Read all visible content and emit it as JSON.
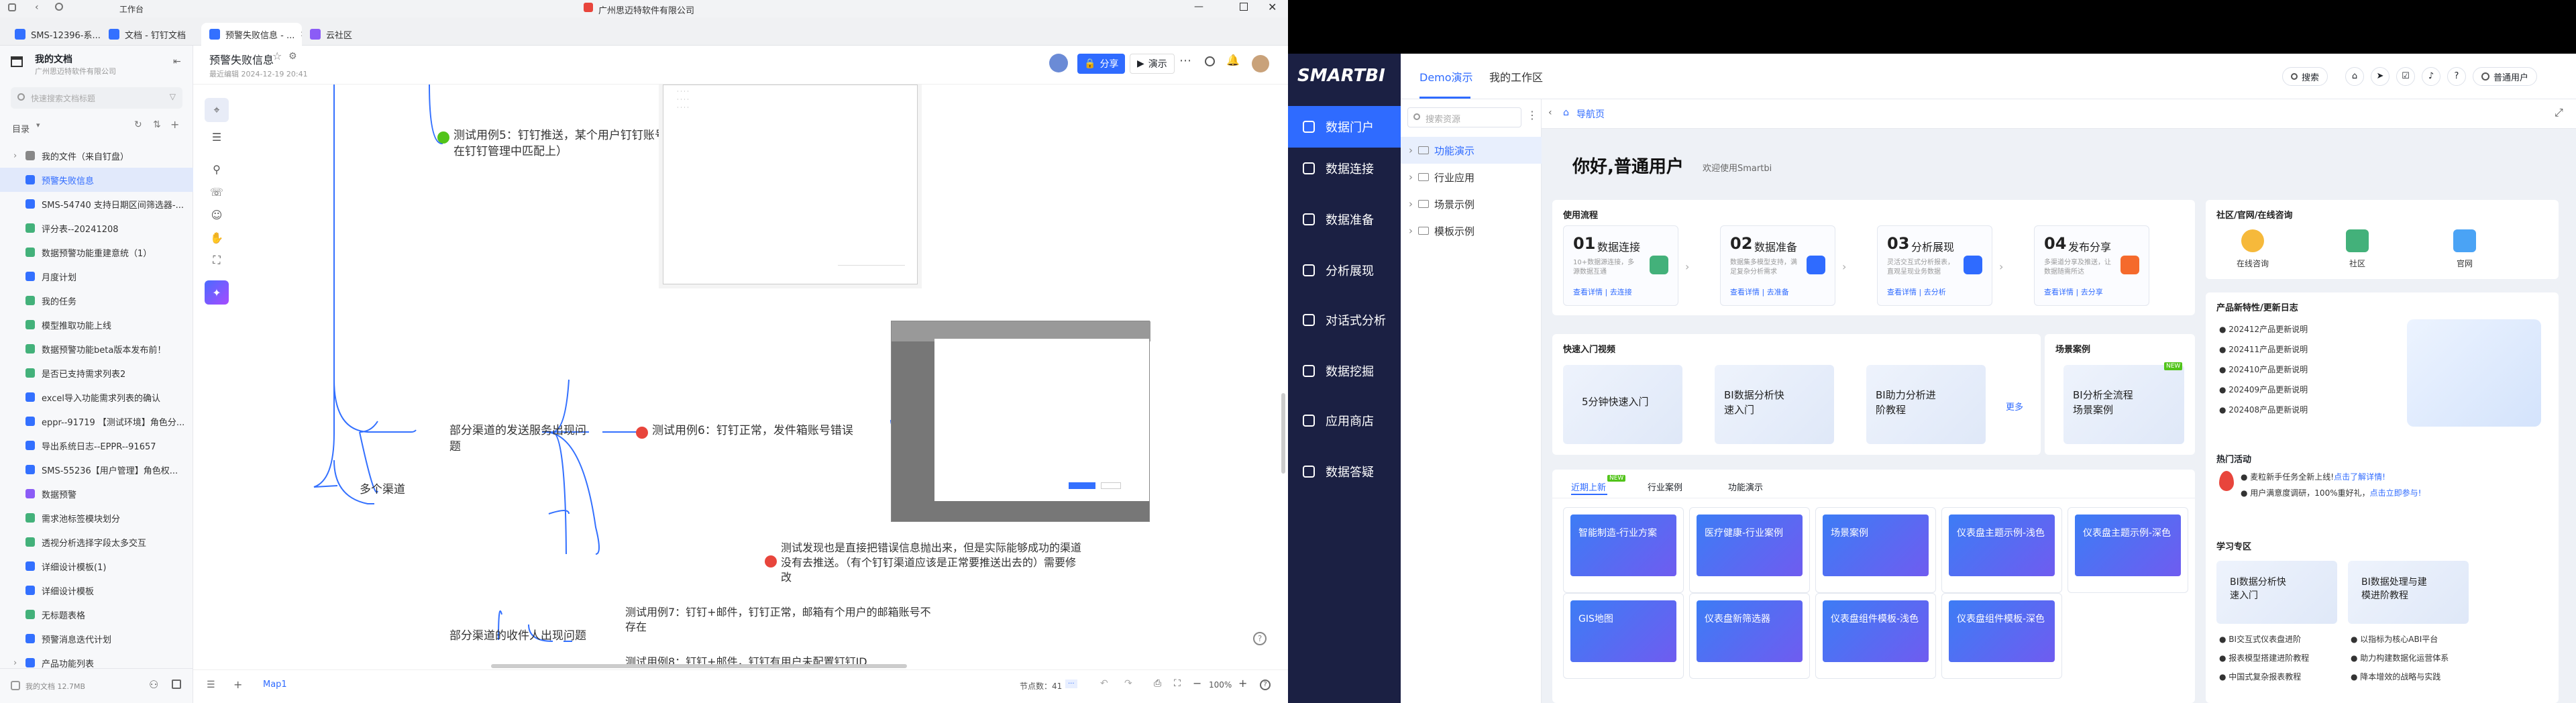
{
  "left_window": {
    "titlebar": {
      "tab_group": "工作台",
      "company": "广州思迈特软件有限公司"
    },
    "tabs": [
      {
        "label": "SMS-12396-系..."
      },
      {
        "label": "文档 - 钉钉文档"
      },
      {
        "label": "预警失败信息 - ..."
      },
      {
        "label": "云社区"
      }
    ],
    "sidebar": {
      "title": "我的文档",
      "subtitle": "广州思迈特软件有限公司",
      "search_placeholder": "快速搜索文档标题",
      "toc_label": "目录",
      "items": [
        {
          "label": "我的文件（来自钉盘）"
        },
        {
          "label": "预警失败信息"
        },
        {
          "label": "SMS-54740 支持日期区间筛选器-..."
        },
        {
          "label": "评分表--20241208"
        },
        {
          "label": "数据预警功能重建意统（1）"
        },
        {
          "label": "月度计划"
        },
        {
          "label": "我的任务"
        },
        {
          "label": "模型推取功能上线"
        },
        {
          "label": "数据预警功能beta版本发布前！"
        },
        {
          "label": "是否已支持需求列表2"
        },
        {
          "label": "excel导入功能需求列表的确认"
        },
        {
          "label": "eppr--91719 【测试环境】角色分..."
        },
        {
          "label": "导出系统日志--EPPR--91657"
        },
        {
          "label": "SMS-55236【用户管理】角色权..."
        },
        {
          "label": "数据预警"
        },
        {
          "label": "需求池标签模块划分"
        },
        {
          "label": "透视分析选择字段太多交互"
        },
        {
          "label": "详细设计模板(1)"
        },
        {
          "label": "详细设计模板"
        },
        {
          "label": "无标题表格"
        },
        {
          "label": "预警消息迭代计划"
        },
        {
          "label": "产品功能列表"
        }
      ],
      "footer": "我的文档 12.7MB"
    },
    "doc": {
      "title": "预警失败信息",
      "meta": "最近编辑 2024-12-19 20:41",
      "share": "分享",
      "present": "演示"
    },
    "mindmap": {
      "nodes": {
        "n_multi": "多个渠道",
        "n_send": "部分渠道的发送服务出现问题",
        "n_recv": "部分渠道的收件人出现问题",
        "case5": "测试用例5：钉钉推送，某个用户钉钉账号未配置（即未在钉钉管理中匹配上）",
        "case6": "测试用例6：钉钉正常，发件箱账号错误",
        "case6_note": "测试发现也是直接把错误信息抛出来，但是实际能够成功的渠道没有去推送。（有个钉钉渠道应该是正常要推送出去的）需要修改",
        "case7": "测试用例7：钉钉+邮件，钉钉正常，邮箱有个用户的邮箱账号不存在",
        "case8": "测试用例8：钉钉+邮件，钉钉有用户未配置钉钉ID"
      }
    },
    "status": {
      "sheet": "Map1",
      "node_count": "节点数：41",
      "zoom": "100%"
    }
  },
  "right_window": {
    "logo": "SMARTBI",
    "top_tabs": [
      {
        "label": "Demo演示"
      },
      {
        "label": "我的工作区"
      }
    ],
    "header_actions": {
      "search": "搜索",
      "user": "普通用户"
    },
    "nav": [
      {
        "label": "数据门户"
      },
      {
        "label": "数据连接"
      },
      {
        "label": "数据准备"
      },
      {
        "label": "分析展现"
      },
      {
        "label": "对话式分析"
      },
      {
        "label": "数据挖掘"
      },
      {
        "label": "应用商店"
      },
      {
        "label": "数据答疑"
      }
    ],
    "tree": {
      "search_placeholder": "搜索资源",
      "nodes": [
        {
          "label": "功能演示"
        },
        {
          "label": "行业应用"
        },
        {
          "label": "场景示例"
        },
        {
          "label": "模板示例"
        }
      ]
    },
    "breadcrumb": "导航页",
    "greeting": {
      "title": "你好,普通用户",
      "sub": "欢迎使用Smartbi"
    },
    "flow": {
      "title": "使用流程",
      "steps": [
        {
          "num": "01",
          "title": "数据连接",
          "desc": "10+数据源连接，多源数据互通",
          "links": "查看详情 | 去连接"
        },
        {
          "num": "02",
          "title": "数据准备",
          "desc": "数据集多模型支持，满足复杂分析需求",
          "links": "查看详情 | 去准备"
        },
        {
          "num": "03",
          "title": "分析展现",
          "desc": "灵活交互式分析报表，直观呈现业务数据",
          "links": "查看详情 | 去分析"
        },
        {
          "num": "04",
          "title": "发布分享",
          "desc": "多渠道分享及推送，让数据随需所达",
          "links": "查看详情 | 去分享"
        }
      ]
    },
    "videos": {
      "title": "快速入门视频",
      "items": [
        {
          "label": "5分钟快速入门"
        },
        {
          "label": "BI数据分析快速入门"
        },
        {
          "label": "BI助力分析进阶教程"
        }
      ],
      "more": "更多"
    },
    "scene": {
      "title": "场景案例",
      "item": "BI分析全流程场景案例",
      "badge": "NEW"
    },
    "recent": {
      "tabs": [
        {
          "label": "近期上新"
        },
        {
          "label": "行业案例"
        },
        {
          "label": "功能演示"
        }
      ],
      "items": [
        {
          "label": "智能制造-行业方案"
        },
        {
          "label": "医疗健康-行业案例"
        },
        {
          "label": "场景案例"
        },
        {
          "label": "仪表盘主题示例-浅色"
        },
        {
          "label": "仪表盘主题示例-深色"
        },
        {
          "label": "GIS地图"
        },
        {
          "label": "仪表盘新筛选器"
        },
        {
          "label": "仪表盘组件模板-浅色"
        },
        {
          "label": "仪表盘组件模板-深色"
        }
      ]
    },
    "community": {
      "title": "社区/官网/在线咨询",
      "items": [
        {
          "label": "在线咨询"
        },
        {
          "label": "社区"
        },
        {
          "label": "官网"
        }
      ]
    },
    "changelog": {
      "title": "产品新特性/更新日志",
      "items": [
        {
          "label": "202412产品更新说明"
        },
        {
          "label": "202411产品更新说明"
        },
        {
          "label": "202410产品更新说明"
        },
        {
          "label": "202409产品更新说明"
        },
        {
          "label": "202408产品更新说明"
        }
      ]
    },
    "events": {
      "title": "热门活动",
      "items": [
        {
          "text": "麦粒新手任务全新上线!",
          "link": "点击了解详情!"
        },
        {
          "text": "用户满意度调研，100%重好礼，",
          "link": "点击立即参与!"
        }
      ]
    },
    "study": {
      "title": "学习专区",
      "cards": [
        {
          "label": "BI数据分析快速入门"
        },
        {
          "label": "BI数据处理与建模进阶教程"
        }
      ],
      "bullets": [
        {
          "label": "BI交互式仪表盘进阶"
        },
        {
          "label": "以指标为核心ABI平台"
        },
        {
          "label": "报表模型搭建进阶教程"
        },
        {
          "label": "助力构建数据化运营体系"
        },
        {
          "label": "中国式复杂报表教程"
        },
        {
          "label": "降本增效的战略与实践"
        }
      ]
    }
  },
  "colors": {
    "accent": "#2f6bff",
    "nav_bg": "#1b2043",
    "mind_line": "#3370ff",
    "red": "#e8453c",
    "green": "#52c41a"
  }
}
